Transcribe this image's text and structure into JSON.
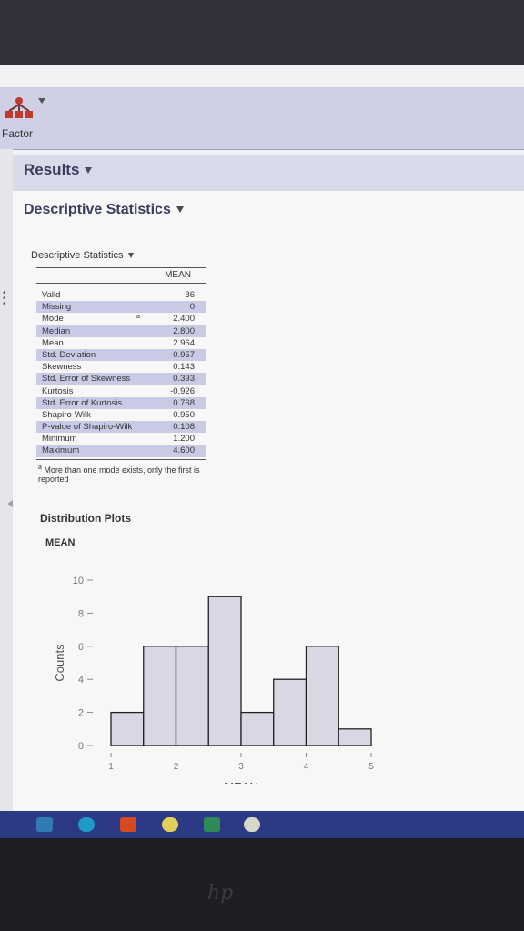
{
  "toolbar": {
    "factor_label": "Factor"
  },
  "results": {
    "title": "Results"
  },
  "section": {
    "title": "Descriptive Statistics"
  },
  "table": {
    "title": "Descriptive Statistics",
    "column_header": "MEAN",
    "rows": [
      {
        "label": "Valid",
        "value": "36"
      },
      {
        "label": "Missing",
        "value": "0"
      },
      {
        "label": "Mode",
        "value": "2.400",
        "mark": "a"
      },
      {
        "label": "Median",
        "value": "2.800"
      },
      {
        "label": "Mean",
        "value": "2.964"
      },
      {
        "label": "Std. Deviation",
        "value": "0.957"
      },
      {
        "label": "Skewness",
        "value": "0.143"
      },
      {
        "label": "Std. Error of Skewness",
        "value": "0.393"
      },
      {
        "label": "Kurtosis",
        "value": "-0.926"
      },
      {
        "label": "Std. Error of Kurtosis",
        "value": "0.768"
      },
      {
        "label": "Shapiro-Wilk",
        "value": "0.950"
      },
      {
        "label": "P-value of Shapiro-Wilk",
        "value": "0.108"
      },
      {
        "label": "Minimum",
        "value": "1.200"
      },
      {
        "label": "Maximum",
        "value": "4.600"
      }
    ],
    "footnote_mark": "a",
    "footnote": "More than one mode exists, only the first is reported"
  },
  "distribution": {
    "title": "Distribution Plots",
    "variable": "MEAN"
  },
  "chart_data": {
    "type": "bar",
    "title": "MEAN",
    "xlabel": "MEAN",
    "ylabel": "Counts",
    "bin_edges": [
      1.0,
      1.5,
      2.0,
      2.5,
      3.0,
      3.5,
      4.0,
      4.5,
      5.0
    ],
    "values": [
      2,
      6,
      6,
      9,
      2,
      4,
      6,
      1
    ],
    "xticks": [
      1,
      2,
      3,
      4,
      5
    ],
    "yticks": [
      0,
      2,
      4,
      6,
      8,
      10
    ],
    "ylim": [
      0,
      10
    ],
    "bar_color": "#d8d8e4",
    "grid": false
  },
  "taskbar": {
    "icons": [
      "mail-icon",
      "edge-icon",
      "office-icon",
      "chrome-icon",
      "excel-icon",
      "jasp-icon"
    ]
  }
}
